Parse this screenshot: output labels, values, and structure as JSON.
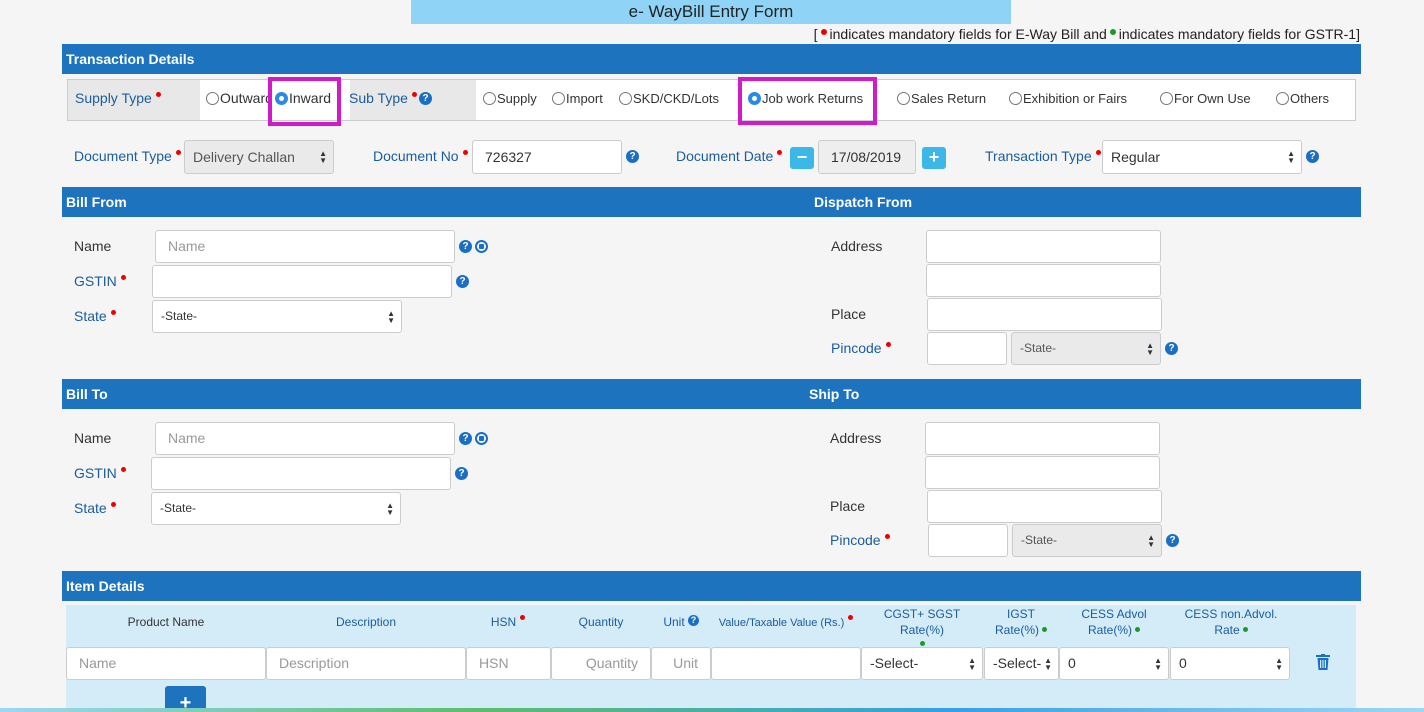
{
  "title": "e- WayBill Entry Form",
  "legend": {
    "open": "[",
    "part1": "indicates mandatory fields for E-Way Bill and",
    "part2": "indicates mandatory fields for GSTR-1]"
  },
  "transaction": {
    "heading": "Transaction Details",
    "supply_type_label": "Supply Type",
    "supply_outward": "Outward",
    "supply_inward": "Inward",
    "sub_type_label": "Sub Type",
    "sub_types": [
      "Supply",
      "Import",
      "SKD/CKD/Lots",
      "Job work Returns",
      "Sales Return",
      "Exhibition or Fairs",
      "For Own Use",
      "Others"
    ],
    "document_type_label": "Document Type",
    "document_type_value": "Delivery Challan",
    "document_no_label": "Document No",
    "document_no_value": "726327",
    "document_date_label": "Document Date",
    "document_date_value": "17/08/2019",
    "transaction_type_label": "Transaction Type",
    "transaction_type_value": "Regular"
  },
  "bill_from": {
    "heading": "Bill From",
    "name_label": "Name",
    "name_placeholder": "Name",
    "gstin_label": "GSTIN",
    "state_label": "State",
    "state_value": "-State-"
  },
  "dispatch_from": {
    "heading": "Dispatch From",
    "address_label": "Address",
    "place_label": "Place",
    "pincode_label": "Pincode",
    "state_value": "-State-"
  },
  "bill_to": {
    "heading": "Bill To",
    "name_label": "Name",
    "name_placeholder": "Name",
    "gstin_label": "GSTIN",
    "state_label": "State",
    "state_value": "-State-"
  },
  "ship_to": {
    "heading": "Ship To",
    "address_label": "Address",
    "place_label": "Place",
    "pincode_label": "Pincode",
    "state_value": "-State-"
  },
  "items": {
    "heading": "Item Details",
    "col_product": "Product Name",
    "col_description": "Description",
    "col_hsn": "HSN",
    "col_quantity": "Quantity",
    "col_unit": "Unit",
    "col_value": "Value/Taxable Value (Rs.)",
    "col_cgst": "CGST+ SGST Rate(%)",
    "col_igst_1": "IGST",
    "col_igst_2": "Rate(%)",
    "col_cess_1": "CESS Advol",
    "col_cess_2": "Rate(%)",
    "col_cessn_1": "CESS non.Advol.",
    "col_cessn_2": "Rate",
    "ph_product": "Name",
    "ph_description": "Description",
    "ph_hsn": "HSN",
    "ph_quantity": "Quantity",
    "ph_unit": "Unit",
    "cgst_value": "-Select-",
    "igst_value": "-Select-",
    "cess_value": "0",
    "cessn_value": "0",
    "add_symbol": "+",
    "minus_symbol": "−"
  },
  "colors": {
    "header": "#1e73be",
    "title_bar": "#8fd3f7",
    "highlight": "#d11ac8"
  }
}
